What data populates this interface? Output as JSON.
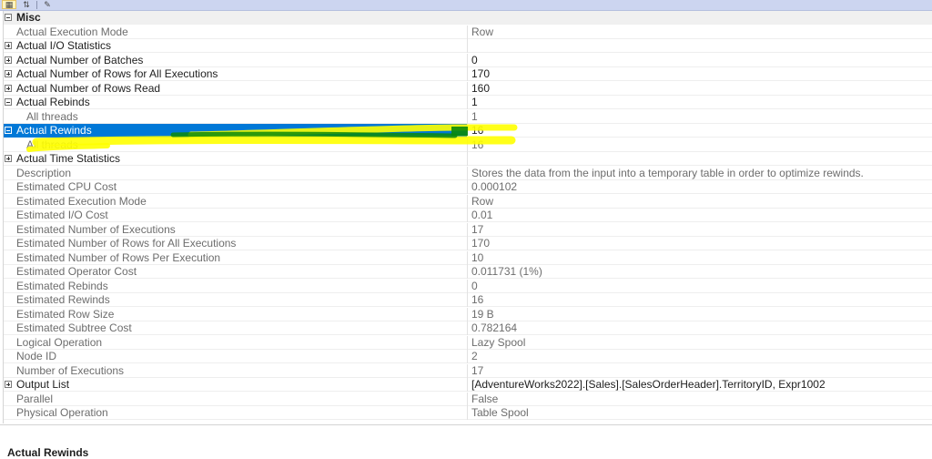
{
  "toolbar": {
    "categorized_icon": "categorized-icon",
    "alphabetical_icon": "alphabetical-icon",
    "property_pages_icon": "wrench-icon"
  },
  "grid": {
    "category": "Misc",
    "rows": [
      {
        "name": "Actual Execution Mode",
        "value": "Row",
        "expander": "none",
        "indent": 1,
        "style": "grey"
      },
      {
        "name": "Actual I/O Statistics",
        "value": "",
        "expander": "plus",
        "indent": 0,
        "style": "bold"
      },
      {
        "name": "Actual Number of Batches",
        "value": "0",
        "expander": "plus",
        "indent": 0,
        "style": "bold"
      },
      {
        "name": "Actual Number of Rows for All Executions",
        "value": "170",
        "expander": "plus",
        "indent": 0,
        "style": "bold"
      },
      {
        "name": "Actual Number of Rows Read",
        "value": "160",
        "expander": "plus",
        "indent": 0,
        "style": "bold"
      },
      {
        "name": "Actual Rebinds",
        "value": "1",
        "expander": "minus",
        "indent": 0,
        "style": "bold"
      },
      {
        "name": "All threads",
        "value": "1",
        "expander": "none",
        "indent": 2,
        "style": "grey"
      },
      {
        "name": "Actual Rewinds",
        "value": "16",
        "expander": "minus",
        "indent": 0,
        "style": "selected"
      },
      {
        "name": "All threads",
        "value": "16",
        "expander": "none",
        "indent": 2,
        "style": "grey"
      },
      {
        "name": "Actual Time Statistics",
        "value": "",
        "expander": "plus",
        "indent": 0,
        "style": "bold"
      },
      {
        "name": "Description",
        "value": "Stores the data from the input into a temporary table in order to optimize rewinds.",
        "expander": "none",
        "indent": 1,
        "style": "grey"
      },
      {
        "name": "Estimated CPU Cost",
        "value": "0.000102",
        "expander": "none",
        "indent": 1,
        "style": "grey"
      },
      {
        "name": "Estimated Execution Mode",
        "value": "Row",
        "expander": "none",
        "indent": 1,
        "style": "grey"
      },
      {
        "name": "Estimated I/O Cost",
        "value": "0.01",
        "expander": "none",
        "indent": 1,
        "style": "grey"
      },
      {
        "name": "Estimated Number of Executions",
        "value": "17",
        "expander": "none",
        "indent": 1,
        "style": "grey"
      },
      {
        "name": "Estimated Number of Rows for All Executions",
        "value": "170",
        "expander": "none",
        "indent": 1,
        "style": "grey"
      },
      {
        "name": "Estimated Number of Rows Per Execution",
        "value": "10",
        "expander": "none",
        "indent": 1,
        "style": "grey"
      },
      {
        "name": "Estimated Operator Cost",
        "value": "0.011731 (1%)",
        "expander": "none",
        "indent": 1,
        "style": "grey"
      },
      {
        "name": "Estimated Rebinds",
        "value": "0",
        "expander": "none",
        "indent": 1,
        "style": "grey"
      },
      {
        "name": "Estimated Rewinds",
        "value": "16",
        "expander": "none",
        "indent": 1,
        "style": "grey"
      },
      {
        "name": "Estimated Row Size",
        "value": "19 B",
        "expander": "none",
        "indent": 1,
        "style": "grey"
      },
      {
        "name": "Estimated Subtree Cost",
        "value": "0.782164",
        "expander": "none",
        "indent": 1,
        "style": "grey"
      },
      {
        "name": "Logical Operation",
        "value": "Lazy Spool",
        "expander": "none",
        "indent": 1,
        "style": "grey"
      },
      {
        "name": "Node ID",
        "value": "2",
        "expander": "none",
        "indent": 1,
        "style": "grey"
      },
      {
        "name": "Number of Executions",
        "value": "17",
        "expander": "none",
        "indent": 1,
        "style": "grey"
      },
      {
        "name": "Output List",
        "value": "[AdventureWorks2022].[Sales].[SalesOrderHeader].TerritoryID, Expr1002",
        "expander": "plus",
        "indent": 0,
        "style": "bold"
      },
      {
        "name": "Parallel",
        "value": "False",
        "expander": "none",
        "indent": 1,
        "style": "grey"
      },
      {
        "name": "Physical Operation",
        "value": "Table Spool",
        "expander": "none",
        "indent": 1,
        "style": "grey"
      }
    ]
  },
  "description_pane": {
    "title": "Actual Rewinds"
  },
  "colors": {
    "selection": "#0078d7",
    "highlighter_yellow": "#ffff00",
    "highlighter_green": "#008000"
  }
}
